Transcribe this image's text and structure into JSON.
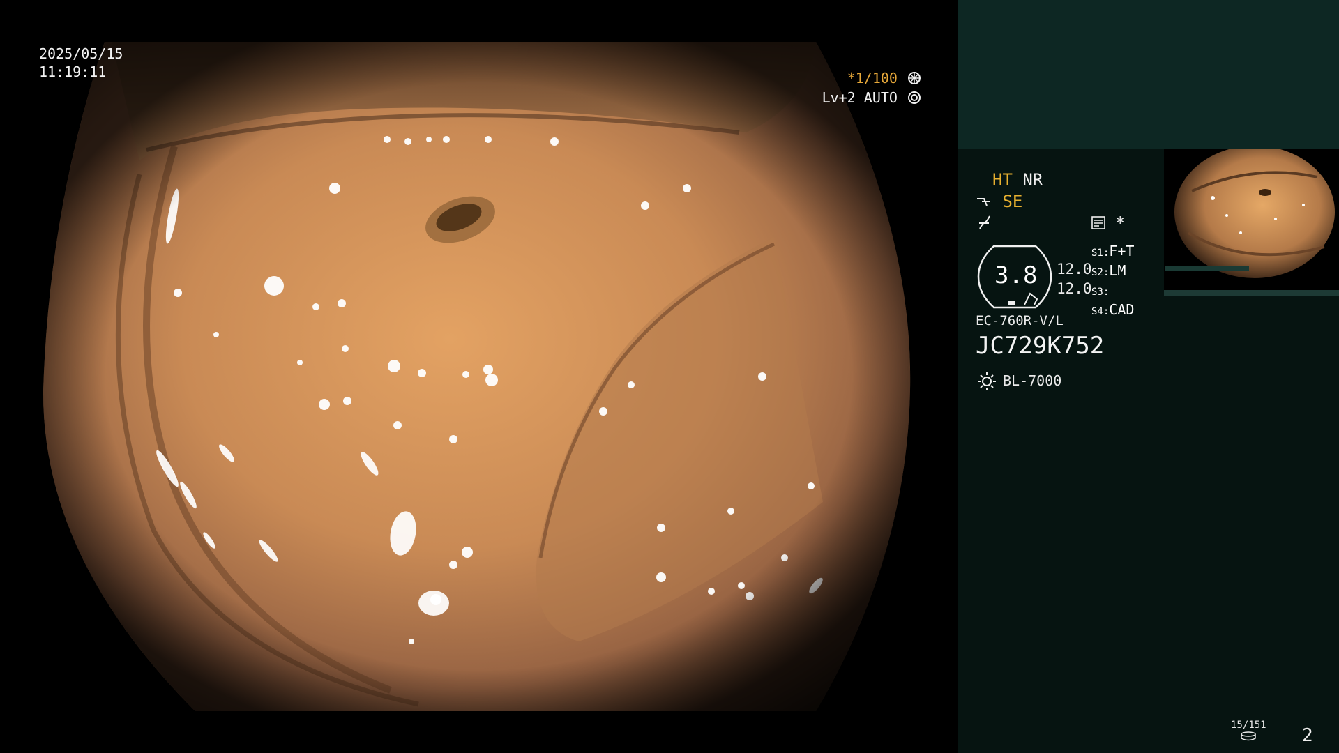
{
  "view": {
    "date": "2025/05/15",
    "time": "11:19:11",
    "shutter": "*1/100",
    "shutter_icon": "aperture-icon",
    "level": "Lv+2",
    "exposure_mode": "AUTO",
    "exposure_icon": "iris-icon"
  },
  "panel": {
    "ht": "HT",
    "nr": "NR",
    "se": "SE",
    "se_icon": "structure-enhance-icon",
    "color_icon": "color-mode-icon",
    "memory_icon": "memory-icon",
    "star": "*",
    "dial_value": "3.8",
    "dial_right_top": "12.0",
    "dial_right_bottom": "12.0",
    "s1_label": "S1:",
    "s1_value": "F+T",
    "s2_label": "S2:",
    "s2_value": "LM",
    "s3_label": "S3:",
    "s3_value": "",
    "s4_label": "S4:",
    "s4_value": "CAD",
    "scope_model": "EC-760R-V/L",
    "scope_serial": "JC729K752",
    "light_icon": "light-source-icon",
    "light_source": "BL-7000",
    "image_counter": "15/151",
    "storage_icon": "storage-icon",
    "page_number": "2",
    "accent_color": "#e8b130",
    "panel_color": "#061411",
    "panel_top_color": "#0d2723"
  }
}
